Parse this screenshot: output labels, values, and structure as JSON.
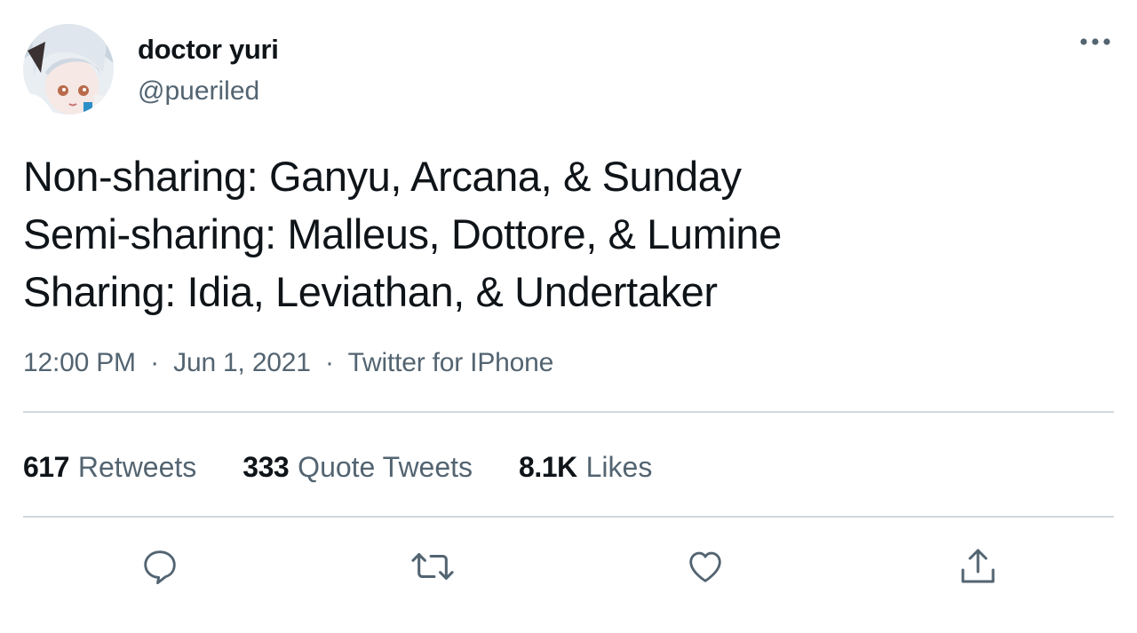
{
  "author": {
    "display_name": "doctor yuri",
    "handle": "@pueriled"
  },
  "tweet": {
    "lines": [
      "Non-sharing: Ganyu, Arcana, & Sunday",
      "Semi-sharing: Malleus, Dottore, & Lumine",
      "Sharing: Idia, Leviathan, & Undertaker"
    ],
    "time": "12:00 PM",
    "separator": "·",
    "date": "Jun 1, 2021",
    "source": "Twitter for IPhone"
  },
  "stats": {
    "retweets": {
      "count": "617",
      "label": "Retweets"
    },
    "quote_tweets": {
      "count": "333",
      "label": "Quote Tweets"
    },
    "likes": {
      "count": "8.1K",
      "label": "Likes"
    }
  },
  "actions": {
    "icons": [
      "reply-icon",
      "retweet-icon",
      "like-icon",
      "share-icon"
    ]
  },
  "colors": {
    "text_primary": "#0f1419",
    "text_secondary": "#536471",
    "divider": "#cfd9de",
    "background": "#ffffff"
  }
}
